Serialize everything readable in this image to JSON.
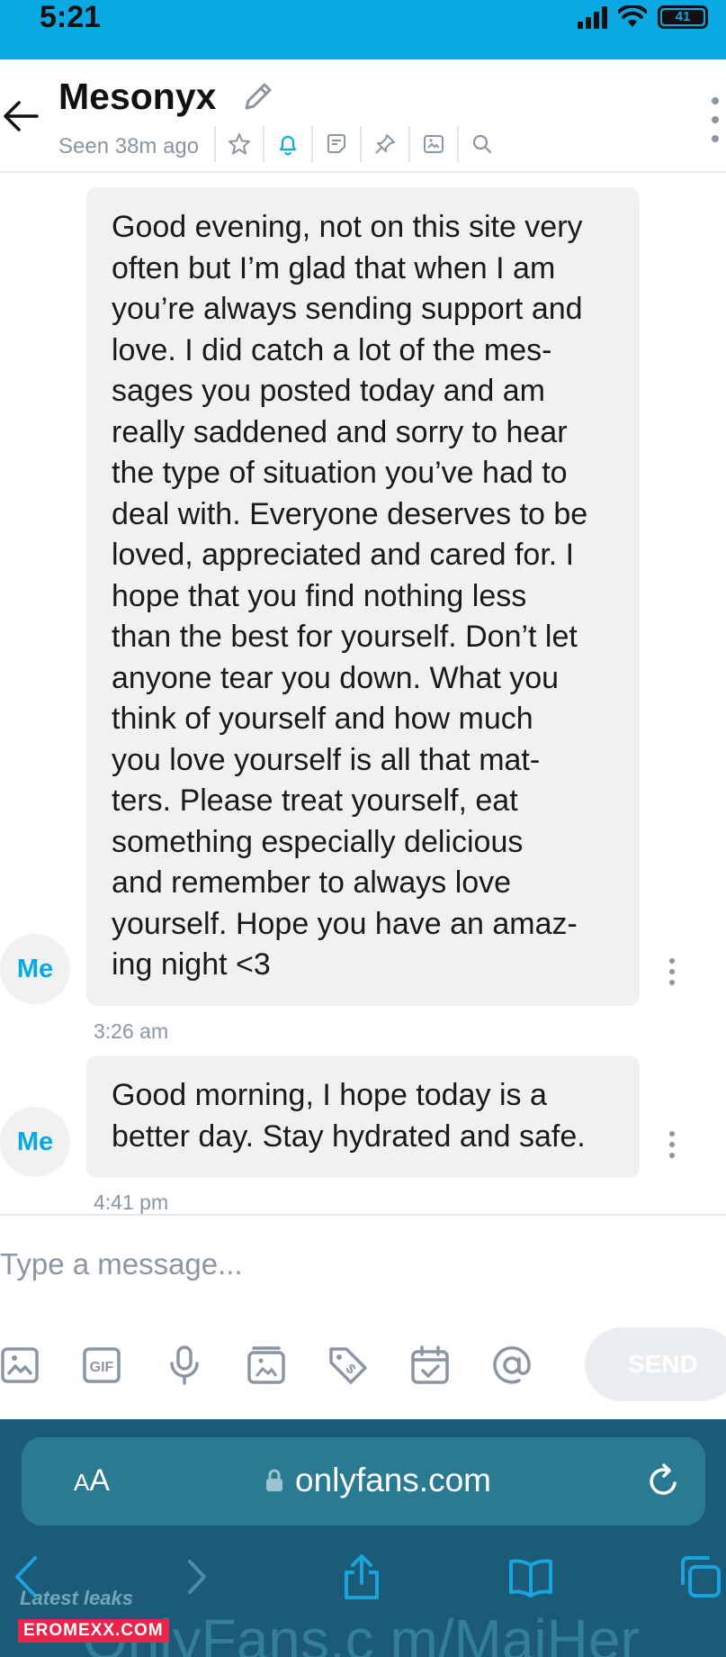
{
  "status_bar": {
    "time": "5:21",
    "battery": "41"
  },
  "header": {
    "contact_name": "Mesonyx",
    "seen_text": "Seen 38m ago",
    "toolbar_icons": [
      "star-icon",
      "bell-icon",
      "note-icon",
      "pin-icon",
      "gallery-icon",
      "search-icon"
    ]
  },
  "messages": [
    {
      "sender": "Me",
      "lines": [
        "Good evening, not on this site very",
        "often but I’m glad that when I am",
        "you’re always sending support and",
        "love. I did catch a lot of the mes-",
        "sages you posted today and am",
        "really saddened and sorry to hear",
        "the type of situation you’ve had to",
        "deal with. Everyone deserves to be",
        "loved, appreciated and cared for. I",
        "hope that you find nothing less",
        "than the best for yourself. Don’t let",
        "anyone tear you down. What you",
        "think of yourself and how much",
        "you love yourself is all that mat-",
        "ters. Please treat yourself, eat",
        "something especially delicious",
        "and remember to always love",
        "yourself. Hope you have an amaz-",
        "ing night <3"
      ],
      "time": "3:26 am"
    },
    {
      "sender": "Me",
      "lines": [
        "Good morning, I hope today is a",
        "better day. Stay hydrated and safe."
      ],
      "time": "4:41 pm"
    }
  ],
  "composer": {
    "placeholder": "Type a message...",
    "tools": [
      "image-icon",
      "gif-icon",
      "microphone-icon",
      "media-vault-icon",
      "price-tag-icon",
      "calendar-icon",
      "mention-icon"
    ],
    "send_label": "SEND"
  },
  "browser": {
    "aa_label_big": "A",
    "aa_label_small": "A",
    "url": "onlyfans.com",
    "watermark_text": "OnlyFans.c m/MaiHer",
    "latest_leaks": "Latest leaks",
    "site_badge": "EROMEXX.COM"
  },
  "colors": {
    "accent": "#0aa9e4",
    "bubble": "#eff1f3",
    "muted": "#8a96a3",
    "browser_bg": "#1c5b77"
  }
}
